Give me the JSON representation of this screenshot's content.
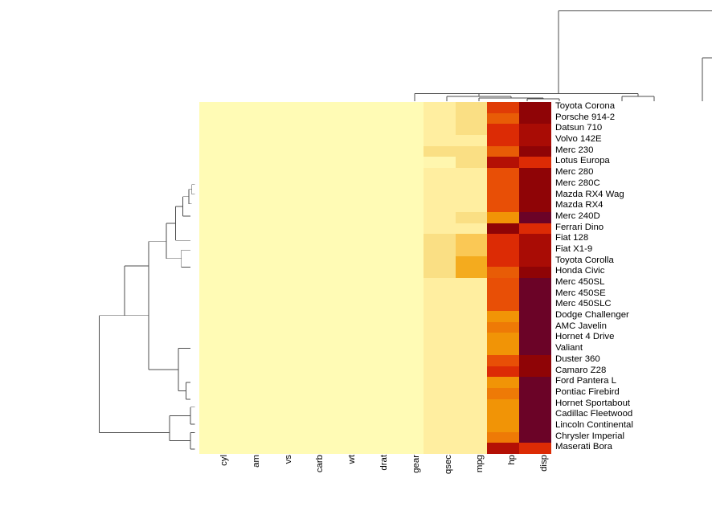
{
  "plot": {
    "type": "heatmap-with-dendrograms",
    "title": "",
    "background": "#ffffff",
    "dendrogram_line_color": "#4d4d4d",
    "label_color": "#000000"
  },
  "chart_data": {
    "type": "heatmap",
    "title": "",
    "xlabel": "",
    "ylabel": "",
    "grid": false,
    "legend": "none",
    "columns": [
      "cyl",
      "am",
      "vs",
      "carb",
      "wt",
      "drat",
      "gear",
      "qsec",
      "mpg",
      "hp",
      "disp"
    ],
    "rows": [
      "Toyota Corona",
      "Porsche 914-2",
      "Datsun 710",
      "Volvo 142E",
      "Merc 230",
      "Lotus Europa",
      "Merc 280",
      "Merc 280C",
      "Mazda RX4 Wag",
      "Mazda RX4",
      "Merc 240D",
      "Ferrari Dino",
      "Fiat 128",
      "Fiat X1-9",
      "Toyota Corolla",
      "Honda Civic",
      "Merc 450SL",
      "Merc 450SE",
      "Merc 450SLC",
      "Dodge Challenger",
      "AMC Javelin",
      "Hornet 4 Drive",
      "Valiant",
      "Duster 360",
      "Camaro Z28",
      "Ford Pantera L",
      "Pontiac Firebird",
      "Hornet Sportabout",
      "Cadillac Fleetwood",
      "Lincoln Continental",
      "Chrysler Imperial",
      "Maserati Bora"
    ],
    "colorscale": "heat.colors (pale yellow -> orange -> dark red)",
    "cell_colors": [
      [
        "#fffbb5",
        "#fffbb5",
        "#fffbb5",
        "#fffbb5",
        "#fffbb5",
        "#fffbb5",
        "#fffbb5",
        "#ffeea0",
        "#fadf84",
        "#e03c06",
        "#8f0406"
      ],
      [
        "#fffbb5",
        "#fffbb5",
        "#fffbb5",
        "#fffbb5",
        "#fffbb5",
        "#fffbb5",
        "#fffbb5",
        "#ffeea0",
        "#fadf84",
        "#e85c06",
        "#8f0406"
      ],
      [
        "#fffbb5",
        "#fffbb5",
        "#fffbb5",
        "#fffbb5",
        "#fffbb5",
        "#fffbb5",
        "#fffbb5",
        "#ffeea0",
        "#fadf84",
        "#dc2b05",
        "#a90c05"
      ],
      [
        "#fffbb5",
        "#fffbb5",
        "#fffbb5",
        "#fffbb5",
        "#fffbb5",
        "#fffbb5",
        "#fffbb5",
        "#ffeea0",
        "#ffeea0",
        "#dc2b05",
        "#a90c05"
      ],
      [
        "#fffbb5",
        "#fffbb5",
        "#fffbb5",
        "#fffbb5",
        "#fffbb5",
        "#fffbb5",
        "#fffbb5",
        "#fadf84",
        "#fadf84",
        "#e85c06",
        "#8f0406"
      ],
      [
        "#fffbb5",
        "#fffbb5",
        "#fffbb5",
        "#fffbb5",
        "#fffbb5",
        "#fffbb5",
        "#fffbb5",
        "#fff6ae",
        "#fadf84",
        "#b41005",
        "#dc2b05"
      ],
      [
        "#fffbb5",
        "#fffbb5",
        "#fffbb5",
        "#fffbb5",
        "#fffbb5",
        "#fffbb5",
        "#fffbb5",
        "#ffeea0",
        "#ffeea0",
        "#e84f06",
        "#8f0406"
      ],
      [
        "#fffbb5",
        "#fffbb5",
        "#fffbb5",
        "#fffbb5",
        "#fffbb5",
        "#fffbb5",
        "#fffbb5",
        "#ffeea0",
        "#ffeea0",
        "#e84f06",
        "#8f0406"
      ],
      [
        "#fffbb5",
        "#fffbb5",
        "#fffbb5",
        "#fffbb5",
        "#fffbb5",
        "#fffbb5",
        "#fffbb5",
        "#ffeea0",
        "#ffeea0",
        "#e84f06",
        "#8f0406"
      ],
      [
        "#fffbb5",
        "#fffbb5",
        "#fffbb5",
        "#fffbb5",
        "#fffbb5",
        "#fffbb5",
        "#fffbb5",
        "#ffeea0",
        "#ffeea0",
        "#e84f06",
        "#8f0406"
      ],
      [
        "#fffbb5",
        "#fffbb5",
        "#fffbb5",
        "#fffbb5",
        "#fffbb5",
        "#fffbb5",
        "#fffbb5",
        "#ffeea0",
        "#fadf84",
        "#f19406",
        "#6b0327"
      ],
      [
        "#fffbb5",
        "#fffbb5",
        "#fffbb5",
        "#fffbb5",
        "#fffbb5",
        "#fffbb5",
        "#fffbb5",
        "#ffeea0",
        "#ffeea0",
        "#8f0406",
        "#dc2b05"
      ],
      [
        "#fffbb5",
        "#fffbb5",
        "#fffbb5",
        "#fffbb5",
        "#fffbb5",
        "#fffbb5",
        "#fffbb5",
        "#fadf84",
        "#fac855",
        "#dc2b05",
        "#a90c05"
      ],
      [
        "#fffbb5",
        "#fffbb5",
        "#fffbb5",
        "#fffbb5",
        "#fffbb5",
        "#fffbb5",
        "#fffbb5",
        "#fadf84",
        "#fac855",
        "#dc2b05",
        "#a90c05"
      ],
      [
        "#fffbb5",
        "#fffbb5",
        "#fffbb5",
        "#fffbb5",
        "#fffbb5",
        "#fffbb5",
        "#fffbb5",
        "#fadf84",
        "#f4ab1e",
        "#dc2b05",
        "#a90c05"
      ],
      [
        "#fffbb5",
        "#fffbb5",
        "#fffbb5",
        "#fffbb5",
        "#fffbb5",
        "#fffbb5",
        "#fffbb5",
        "#fadf84",
        "#f4ab1e",
        "#e85c06",
        "#8f0406"
      ],
      [
        "#fffbb5",
        "#fffbb5",
        "#fffbb5",
        "#fffbb5",
        "#fffbb5",
        "#fffbb5",
        "#fffbb5",
        "#ffeea0",
        "#ffeea0",
        "#e84f06",
        "#6b0327"
      ],
      [
        "#fffbb5",
        "#fffbb5",
        "#fffbb5",
        "#fffbb5",
        "#fffbb5",
        "#fffbb5",
        "#fffbb5",
        "#ffeea0",
        "#ffeea0",
        "#e84f06",
        "#6b0327"
      ],
      [
        "#fffbb5",
        "#fffbb5",
        "#fffbb5",
        "#fffbb5",
        "#fffbb5",
        "#fffbb5",
        "#fffbb5",
        "#ffeea0",
        "#ffeea0",
        "#e84f06",
        "#6b0327"
      ],
      [
        "#fffbb5",
        "#fffbb5",
        "#fffbb5",
        "#fffbb5",
        "#fffbb5",
        "#fffbb5",
        "#fffbb5",
        "#ffeea0",
        "#ffeea0",
        "#f19406",
        "#6b0327"
      ],
      [
        "#fffbb5",
        "#fffbb5",
        "#fffbb5",
        "#fffbb5",
        "#fffbb5",
        "#fffbb5",
        "#fffbb5",
        "#ffeea0",
        "#ffeea0",
        "#ee7a06",
        "#6b0327"
      ],
      [
        "#fffbb5",
        "#fffbb5",
        "#fffbb5",
        "#fffbb5",
        "#fffbb5",
        "#fffbb5",
        "#fffbb5",
        "#ffeea0",
        "#ffeea0",
        "#f19406",
        "#6b0327"
      ],
      [
        "#fffbb5",
        "#fffbb5",
        "#fffbb5",
        "#fffbb5",
        "#fffbb5",
        "#fffbb5",
        "#fffbb5",
        "#ffeea0",
        "#ffeea0",
        "#f19406",
        "#6b0327"
      ],
      [
        "#fffbb5",
        "#fffbb5",
        "#fffbb5",
        "#fffbb5",
        "#fffbb5",
        "#fffbb5",
        "#fffbb5",
        "#ffeea0",
        "#ffeea0",
        "#e84f06",
        "#8f0406"
      ],
      [
        "#fffbb5",
        "#fffbb5",
        "#fffbb5",
        "#fffbb5",
        "#fffbb5",
        "#fffbb5",
        "#fffbb5",
        "#ffeea0",
        "#ffeea0",
        "#dc2b05",
        "#8f0406"
      ],
      [
        "#fffbb5",
        "#fffbb5",
        "#fffbb5",
        "#fffbb5",
        "#fffbb5",
        "#fffbb5",
        "#fffbb5",
        "#ffeea0",
        "#ffeea0",
        "#f19406",
        "#6b0327"
      ],
      [
        "#fffbb5",
        "#fffbb5",
        "#fffbb5",
        "#fffbb5",
        "#fffbb5",
        "#fffbb5",
        "#fffbb5",
        "#ffeea0",
        "#ffeea0",
        "#ee7a06",
        "#6b0327"
      ],
      [
        "#fffbb5",
        "#fffbb5",
        "#fffbb5",
        "#fffbb5",
        "#fffbb5",
        "#fffbb5",
        "#fffbb5",
        "#ffeea0",
        "#ffeea0",
        "#f19406",
        "#6b0327"
      ],
      [
        "#fffbb5",
        "#fffbb5",
        "#fffbb5",
        "#fffbb5",
        "#fffbb5",
        "#fffbb5",
        "#fffbb5",
        "#ffeea0",
        "#ffeea0",
        "#f19406",
        "#6b0327"
      ],
      [
        "#fffbb5",
        "#fffbb5",
        "#fffbb5",
        "#fffbb5",
        "#fffbb5",
        "#fffbb5",
        "#fffbb5",
        "#ffeea0",
        "#ffeea0",
        "#f19406",
        "#6b0327"
      ],
      [
        "#fffbb5",
        "#fffbb5",
        "#fffbb5",
        "#fffbb5",
        "#fffbb5",
        "#fffbb5",
        "#fffbb5",
        "#ffeea0",
        "#ffeea0",
        "#ee7a06",
        "#6b0327"
      ],
      [
        "#fffbb5",
        "#fffbb5",
        "#fffbb5",
        "#fffbb5",
        "#fffbb5",
        "#fffbb5",
        "#fffbb5",
        "#ffeea0",
        "#ffeea0",
        "#b41005",
        "#dc2b05"
      ]
    ]
  },
  "col_dendrogram": {
    "orientation": "top",
    "segments": [
      [
        447,
        10,
        646,
        10
      ],
      [
        447,
        10,
        447,
        108
      ],
      [
        646,
        10,
        646,
        70
      ],
      [
        626,
        70,
        666,
        70
      ],
      [
        626,
        70,
        626,
        126
      ],
      [
        666,
        70,
        666,
        126
      ],
      [
        268,
        116,
        447,
        116
      ],
      [
        268,
        116,
        268,
        122
      ],
      [
        268,
        122,
        268,
        126
      ],
      [
        348,
        116,
        348,
        120
      ],
      [
        308,
        120,
        388,
        120
      ],
      [
        308,
        120,
        308,
        123
      ],
      [
        308,
        123,
        308,
        126
      ],
      [
        388,
        120,
        388,
        122
      ],
      [
        348,
        122,
        428,
        122
      ],
      [
        348,
        122,
        348,
        126
      ],
      [
        428,
        122,
        428,
        123
      ],
      [
        408,
        123,
        448,
        123
      ],
      [
        408,
        123,
        408,
        126
      ],
      [
        448,
        123,
        448,
        126
      ],
      [
        447,
        108,
        447,
        116
      ],
      [
        447,
        116,
        546,
        116
      ],
      [
        546,
        116,
        546,
        120
      ],
      [
        526,
        120,
        566,
        120
      ],
      [
        526,
        120,
        526,
        126
      ],
      [
        566,
        120,
        566,
        126
      ]
    ]
  },
  "row_dendrogram": {
    "orientation": "left",
    "segments": [
      [
        6,
        352,
        6,
        545
      ],
      [
        6,
        352,
        72,
        352
      ],
      [
        6,
        545,
        100,
        545
      ],
      [
        72,
        352,
        72,
        441
      ],
      [
        72,
        270,
        72,
        352
      ],
      [
        72,
        270,
        40,
        270
      ],
      [
        40,
        270,
        40,
        352
      ],
      [
        100,
        545,
        100,
        517
      ],
      [
        100,
        517,
        128,
        517
      ],
      [
        100,
        517,
        100,
        558
      ],
      [
        100,
        558,
        128,
        558
      ],
      [
        72,
        441,
        112,
        441
      ],
      [
        112,
        441,
        112,
        406
      ],
      [
        112,
        406,
        128,
        406
      ],
      [
        112,
        406,
        112,
        476
      ],
      [
        112,
        476,
        122,
        476
      ],
      [
        122,
        476,
        122,
        462
      ],
      [
        122,
        462,
        128,
        462
      ],
      [
        122,
        476,
        122,
        490
      ],
      [
        122,
        490,
        128,
        490
      ],
      [
        128,
        517,
        128,
        503
      ],
      [
        128,
        503,
        134,
        503
      ],
      [
        128,
        517,
        128,
        531
      ],
      [
        128,
        531,
        134,
        531
      ],
      [
        128,
        558,
        128,
        545
      ],
      [
        128,
        545,
        134,
        545
      ],
      [
        128,
        558,
        128,
        572
      ],
      [
        128,
        572,
        134,
        572
      ],
      [
        72,
        270,
        72,
        230
      ],
      [
        72,
        230,
        96,
        230
      ],
      [
        96,
        230,
        96,
        200
      ],
      [
        96,
        200,
        108,
        200
      ],
      [
        96,
        200,
        96,
        258
      ],
      [
        96,
        258,
        116,
        258
      ],
      [
        116,
        258,
        116,
        244
      ],
      [
        116,
        244,
        128,
        244
      ],
      [
        116,
        258,
        116,
        272
      ],
      [
        116,
        272,
        128,
        272
      ],
      [
        108,
        200,
        108,
        172
      ],
      [
        108,
        172,
        118,
        172
      ],
      [
        108,
        200,
        108,
        228
      ],
      [
        108,
        228,
        128,
        228
      ],
      [
        118,
        172,
        118,
        156
      ],
      [
        118,
        156,
        126,
        156
      ],
      [
        118,
        172,
        118,
        188
      ],
      [
        118,
        188,
        128,
        188
      ],
      [
        126,
        156,
        126,
        144
      ],
      [
        126,
        144,
        130,
        144
      ],
      [
        126,
        156,
        126,
        168
      ],
      [
        126,
        168,
        130,
        168
      ],
      [
        130,
        144,
        130,
        136
      ],
      [
        130,
        136,
        134,
        136
      ],
      [
        130,
        144,
        130,
        152
      ],
      [
        130,
        152,
        134,
        152
      ]
    ]
  }
}
